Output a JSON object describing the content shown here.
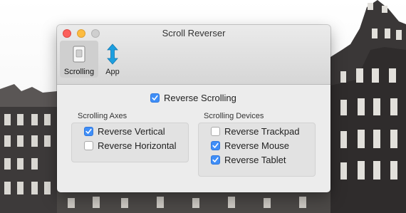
{
  "window": {
    "title": "Scroll Reverser"
  },
  "toolbar": {
    "items": [
      {
        "label": "Scrolling",
        "icon": "scrolling-panel-icon",
        "active": true
      },
      {
        "label": "App",
        "icon": "vertical-arrows-icon",
        "active": false
      }
    ]
  },
  "main": {
    "reverse_scrolling": {
      "label": "Reverse Scrolling",
      "checked": true
    },
    "axes": {
      "title": "Scrolling Axes",
      "options": [
        {
          "label": "Reverse Vertical",
          "checked": true
        },
        {
          "label": "Reverse Horizontal",
          "checked": false
        }
      ]
    },
    "devices": {
      "title": "Scrolling Devices",
      "options": [
        {
          "label": "Reverse Trackpad",
          "checked": false
        },
        {
          "label": "Reverse Mouse",
          "checked": true
        },
        {
          "label": "Reverse Tablet",
          "checked": true
        }
      ]
    }
  },
  "colors": {
    "accent": "#3f8ef7",
    "close": "#fc605c",
    "minimize": "#fdbc40",
    "zoom": "#cfcfcf"
  }
}
